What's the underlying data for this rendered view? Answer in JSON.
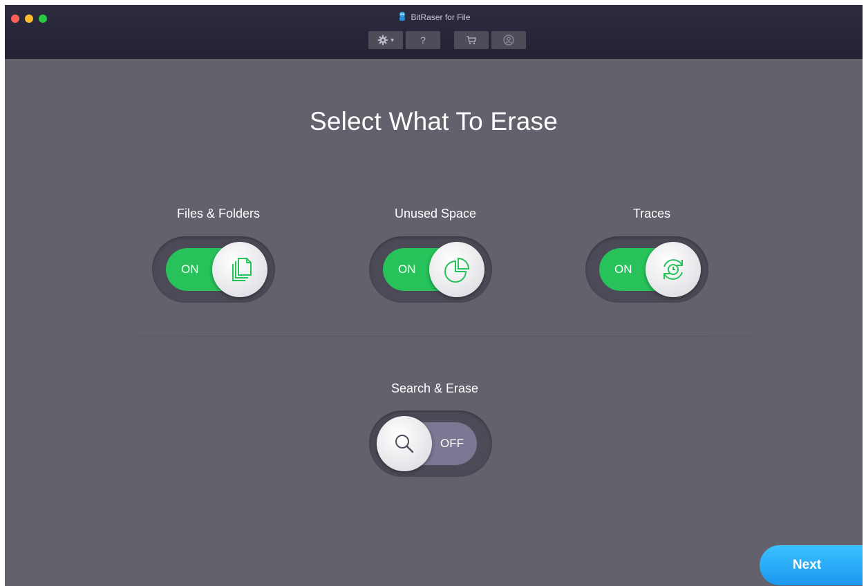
{
  "window": {
    "title": "BitRaser for File",
    "traffic_lights": [
      "#fe5f57",
      "#febb2e",
      "#28c840"
    ],
    "toolbar": {
      "settings": {
        "icon": "gear-icon",
        "arrow": "▾"
      },
      "help": {
        "label": "?"
      },
      "cart": {
        "icon": "cart-icon"
      },
      "account": {
        "icon": "user-icon"
      }
    }
  },
  "main": {
    "title": "Select What To Erase",
    "options": [
      {
        "label": "Files & Folders",
        "state": "ON",
        "icon": "files-icon"
      },
      {
        "label": "Unused Space",
        "state": "ON",
        "icon": "pie-chart-icon"
      },
      {
        "label": "Traces",
        "state": "ON",
        "icon": "history-icon"
      }
    ],
    "search": {
      "label": "Search & Erase",
      "state": "OFF",
      "icon": "search-icon"
    },
    "next_label": "Next"
  },
  "colors": {
    "on": "#27c25a",
    "off": "#7a7893",
    "accent": "#1a98ef",
    "background": "#62616c"
  }
}
